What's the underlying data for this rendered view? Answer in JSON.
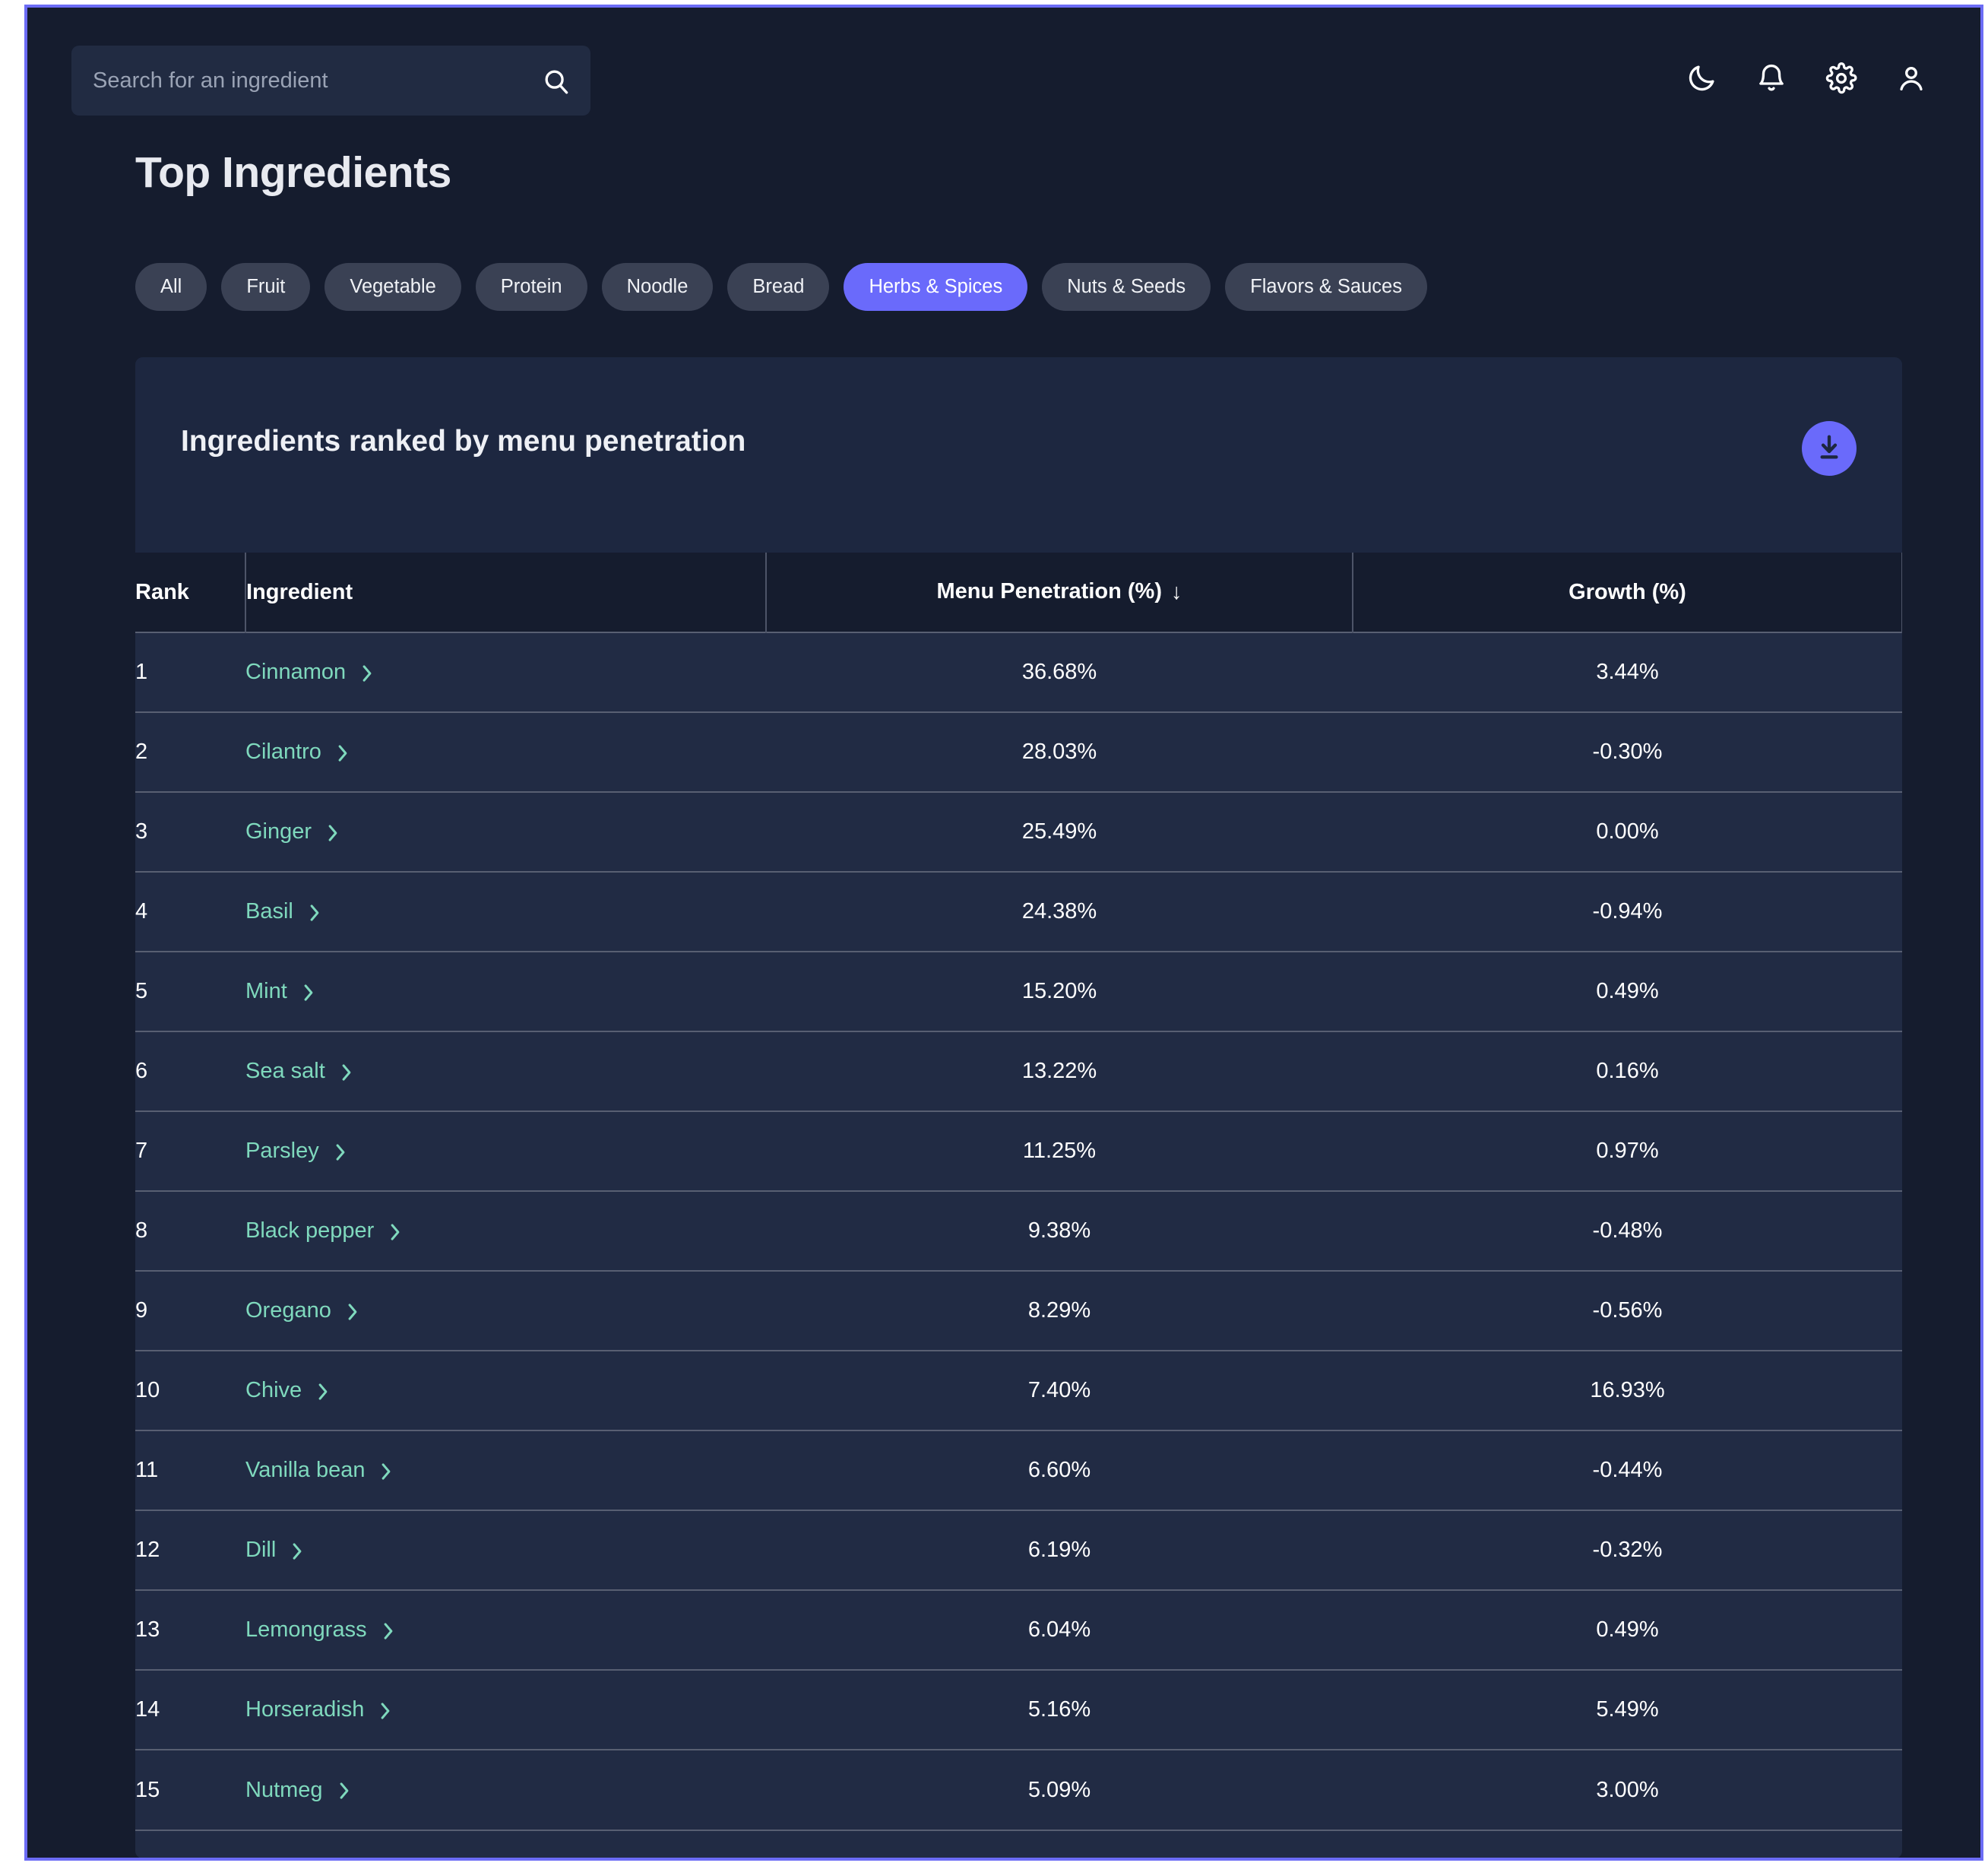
{
  "search": {
    "placeholder": "Search for an ingredient",
    "value": "",
    "icon": "search-icon"
  },
  "topbar": {
    "icons": [
      {
        "name": "dark-mode-icon",
        "label": "moon"
      },
      {
        "name": "notifications-icon",
        "label": "bell"
      },
      {
        "name": "settings-icon",
        "label": "gear"
      },
      {
        "name": "account-icon",
        "label": "person"
      }
    ]
  },
  "page": {
    "title": "Top Ingredients"
  },
  "filters": {
    "active": "Herbs & Spices",
    "items": [
      {
        "label": "All",
        "active": false
      },
      {
        "label": "Fruit",
        "active": false
      },
      {
        "label": "Vegetable",
        "active": false
      },
      {
        "label": "Protein",
        "active": false
      },
      {
        "label": "Noodle",
        "active": false
      },
      {
        "label": "Bread",
        "active": false
      },
      {
        "label": "Herbs & Spices",
        "active": true
      },
      {
        "label": "Nuts & Seeds",
        "active": false
      },
      {
        "label": "Flavors & Sauces",
        "active": false
      }
    ]
  },
  "card": {
    "title": "Ingredients ranked by menu penetration",
    "download_icon": "download-icon"
  },
  "table": {
    "columns": [
      {
        "key": "rank",
        "label": "Rank"
      },
      {
        "key": "ingredient",
        "label": "Ingredient"
      },
      {
        "key": "penetration",
        "label": "Menu Penetration (%)",
        "sort": "desc",
        "sort_glyph": "↓"
      },
      {
        "key": "growth",
        "label": "Growth (%)"
      }
    ],
    "rows": [
      {
        "rank": "1",
        "ingredient": "Cinnamon",
        "penetration": "36.68%",
        "growth": "3.44%"
      },
      {
        "rank": "2",
        "ingredient": "Cilantro",
        "penetration": "28.03%",
        "growth": "-0.30%"
      },
      {
        "rank": "3",
        "ingredient": "Ginger",
        "penetration": "25.49%",
        "growth": "0.00%"
      },
      {
        "rank": "4",
        "ingredient": "Basil",
        "penetration": "24.38%",
        "growth": "-0.94%"
      },
      {
        "rank": "5",
        "ingredient": "Mint",
        "penetration": "15.20%",
        "growth": "0.49%"
      },
      {
        "rank": "6",
        "ingredient": "Sea salt",
        "penetration": "13.22%",
        "growth": "0.16%"
      },
      {
        "rank": "7",
        "ingredient": "Parsley",
        "penetration": "11.25%",
        "growth": "0.97%"
      },
      {
        "rank": "8",
        "ingredient": "Black pepper",
        "penetration": "9.38%",
        "growth": "-0.48%"
      },
      {
        "rank": "9",
        "ingredient": "Oregano",
        "penetration": "8.29%",
        "growth": "-0.56%"
      },
      {
        "rank": "10",
        "ingredient": "Chive",
        "penetration": "7.40%",
        "growth": "16.93%"
      },
      {
        "rank": "11",
        "ingredient": "Vanilla bean",
        "penetration": "6.60%",
        "growth": "-0.44%"
      },
      {
        "rank": "12",
        "ingredient": "Dill",
        "penetration": "6.19%",
        "growth": "-0.32%"
      },
      {
        "rank": "13",
        "ingredient": "Lemongrass",
        "penetration": "6.04%",
        "growth": "0.49%"
      },
      {
        "rank": "14",
        "ingredient": "Horseradish",
        "penetration": "5.16%",
        "growth": "5.49%"
      },
      {
        "rank": "15",
        "ingredient": "Nutmeg",
        "penetration": "5.09%",
        "growth": "3.00%"
      }
    ]
  },
  "colors": {
    "page_background": "#151c2e",
    "frame_border": "#6c6cf5",
    "card_background": "#1d2740",
    "row_background": "#212b44",
    "accent": "#6a6afb",
    "ingredient_link": "#7fd9bd",
    "pill_inactive": "#3a4154",
    "text_primary": "#ffffff"
  }
}
